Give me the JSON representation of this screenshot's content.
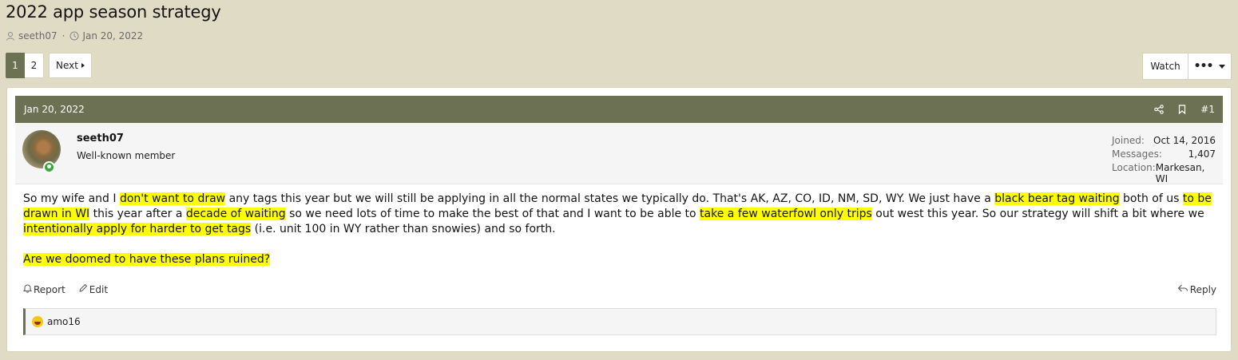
{
  "thread": {
    "title": "2022 app season strategy",
    "author": "seeth07",
    "separator": "·",
    "date": "Jan 20, 2022"
  },
  "pagination": {
    "pages": [
      "1",
      "2"
    ],
    "current": "1",
    "next_label": "Next"
  },
  "thread_actions": {
    "watch_label": "Watch",
    "more_label": "•••"
  },
  "post": {
    "date": "Jan 20, 2022",
    "number": "#1",
    "user": {
      "name": "seeth07",
      "title": "Well-known member",
      "stats": [
        {
          "label": "Joined:",
          "value": "Oct 14, 2016"
        },
        {
          "label": "Messages:",
          "value": "1,407"
        },
        {
          "label": "Location:",
          "value": "Markesan, WI"
        }
      ]
    },
    "body": {
      "s1": "So my wife and I ",
      "h1": "don't want to draw",
      "s2": " any tags this year but we will still be applying in all the normal states we typically do. That's AK, AZ, CO, ID, NM, SD, WY. We just have a ",
      "h2": "black bear tag waiting",
      "s3": " both of us ",
      "h3": "to be drawn in WI",
      "s4": " this year after a ",
      "h4": "decade of waiting",
      "s5": " so we need lots of time to make the best of that and I want to be able to ",
      "h5": "take a few waterfowl only trips",
      "s6": " out west this year. So our strategy will shift a bit where we ",
      "h6": "intentionally apply for harder to get tags",
      "s7": " (i.e. unit 100 in WY rather than snowies) and so forth.",
      "question": "Are we doomed to have these plans ruined?"
    },
    "actions": {
      "report": "Report",
      "edit": "Edit",
      "reply": "Reply"
    },
    "reactions": {
      "users": "amo16"
    }
  },
  "colors": {
    "header": "#6b7152",
    "background": "#e0dbc4",
    "highlight": "#ffff00"
  }
}
